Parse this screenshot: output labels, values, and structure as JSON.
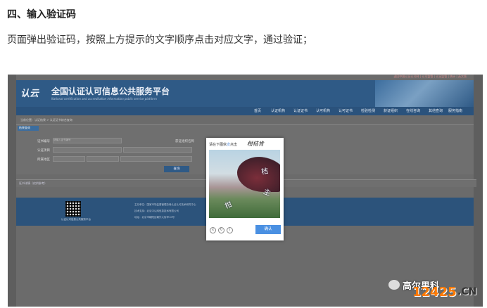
{
  "article": {
    "heading": "四、输入验证码",
    "description": "页面弹出验证码，按照上方提示的文字顺序点击对应文字，通过验证；"
  },
  "site": {
    "top_links": "返回中国认证认可网 | 认可监管 | 认证监管 | 统计 | 英文版",
    "logo_text": "认云",
    "title": "全国认证认可信息公共服务平台",
    "subtitle": "National certification and accreditation information public service platform",
    "nav": [
      "首页",
      "认证机构",
      "认证证书",
      "认可机构",
      "认可证书",
      "检验检测",
      "获证组织",
      "在线咨询",
      "其他查询",
      "服务指南",
      "帮助"
    ],
    "breadcrumb": "当前位置：认证结果 > 认证证书综合查询",
    "panel_tab": "结果查询",
    "fields": {
      "cert_no_label": "证书编号",
      "cert_no_placeholder": "请输入证书编号",
      "org_label": "获证组织名称",
      "cert_type_label": "认证项目",
      "region_label": "所属地区"
    },
    "search_button": "查询",
    "section_title": "证书详情（仅供参考）",
    "footer": {
      "qr_caption": "认证认可信息公共服务平台",
      "lines": [
        "主办单位：国家市场监督管理总局认证认可技术研究中心",
        "技术支持：北京中认网信息技术有限公司",
        "地址：北京市朝阳区朝外大街甲10号"
      ]
    }
  },
  "captcha": {
    "prompt_prefix": "请在下图依",
    "prompt_highlight": "次",
    "prompt_suffix": "点击",
    "target_chars": "柑桔肯",
    "image_chars": [
      "桔",
      "主",
      "柑"
    ],
    "refresh_icon": "refresh-icon",
    "close_icon": "close-icon",
    "info_icon": "info-icon",
    "confirm_label": "确认"
  },
  "watermark": {
    "brand": "高尔果科",
    "site_num": "12425",
    "site_tld": ".CN"
  }
}
